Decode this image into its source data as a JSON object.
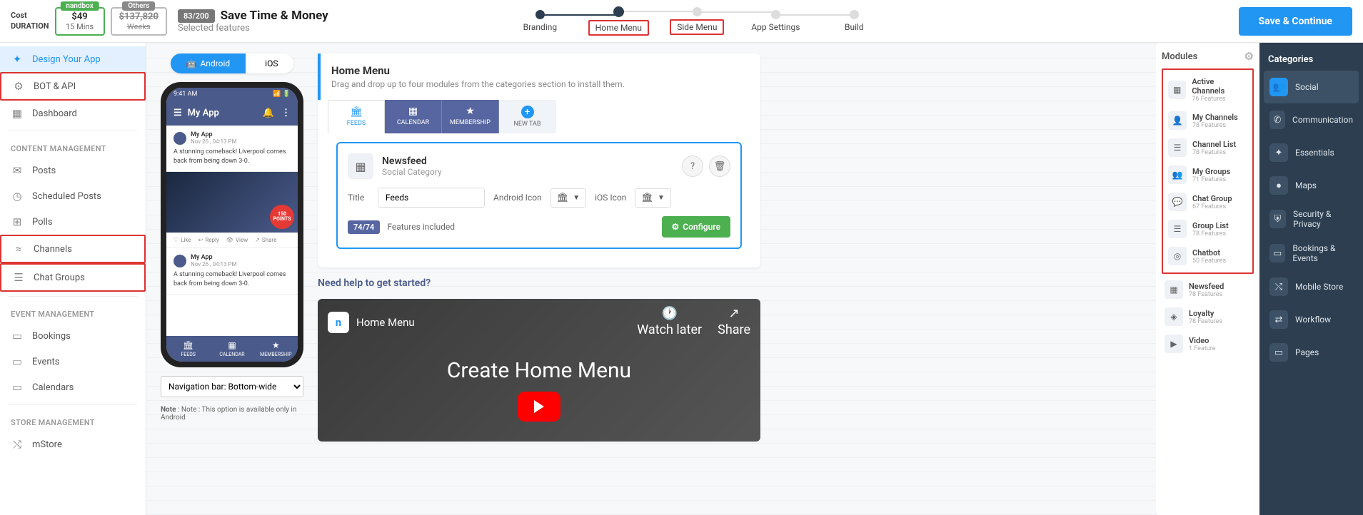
{
  "header": {
    "cost_label_line1": "Cost",
    "cost_label_line2": "DURATION",
    "nandbox": {
      "tag": "nandbox",
      "price": "$49",
      "time": "15 Mins"
    },
    "others": {
      "tag": "Others",
      "price": "$137,820",
      "time": "Weeks"
    },
    "counter": "83/200",
    "title": "Save Time & Money",
    "subtitle": "Selected features",
    "steps": [
      "Branding",
      "Home Menu",
      "Side Menu",
      "App Settings",
      "Build"
    ],
    "save_btn": "Save & Continue"
  },
  "sidebar": {
    "main": [
      {
        "icon": "✦",
        "label": "Design Your App"
      },
      {
        "icon": "⚙",
        "label": "BOT & API"
      },
      {
        "icon": "▦",
        "label": "Dashboard"
      }
    ],
    "content_section": "CONTENT MANAGEMENT",
    "content": [
      {
        "icon": "✉",
        "label": "Posts"
      },
      {
        "icon": "◷",
        "label": "Scheduled Posts"
      },
      {
        "icon": "⊞",
        "label": "Polls"
      },
      {
        "icon": "≈",
        "label": "Channels"
      },
      {
        "icon": "☰",
        "label": "Chat Groups"
      }
    ],
    "event_section": "EVENT MANAGEMENT",
    "event": [
      {
        "icon": "▭",
        "label": "Bookings"
      },
      {
        "icon": "▭",
        "label": "Events"
      },
      {
        "icon": "▭",
        "label": "Calendars"
      }
    ],
    "store_section": "STORE MANAGEMENT",
    "store": [
      {
        "icon": "⤭",
        "label": "mStore"
      }
    ]
  },
  "preview": {
    "platform_android": "Android",
    "platform_ios": "iOS",
    "time": "9:41 AM",
    "app_name": "My App",
    "post_author": "My App",
    "post_time": "Nov 26 , 04:13 PM",
    "post_body": "A stunning comeback! Liverpool comes back from being down 3-0.",
    "points_num": "150",
    "points_label": "POINTS",
    "like": "Like",
    "reply": "Reply",
    "view": "View",
    "share": "Share",
    "tabs": [
      "FEEDS",
      "CALENDAR",
      "MEMBERSHIP"
    ],
    "nav_select": "Navigation bar: Bottom-wide",
    "nav_note": "Note : This option is available only in Android"
  },
  "editor": {
    "home_title": "Home Menu",
    "home_sub": "Drag and drop up to four modules from the categories section to install them.",
    "tabs": [
      {
        "icon": "🏛",
        "label": "FEEDS"
      },
      {
        "icon": "▦",
        "label": "CALENDAR"
      },
      {
        "icon": "★",
        "label": "MEMBERSHIP"
      },
      {
        "icon": "+",
        "label": "NEW TAB"
      }
    ],
    "module": {
      "title": "Newsfeed",
      "category": "Social Category",
      "title_label": "Title",
      "title_value": "Feeds",
      "android_icon_label": "Android Icon",
      "ios_icon_label": "iOS Icon",
      "features_badge": "74/74",
      "features_text": "Features included",
      "configure": "Configure"
    },
    "help_title": "Need help to get started?",
    "video_title": "Home Menu",
    "video_main": "Create Home Menu",
    "watch_later": "Watch later",
    "share": "Share"
  },
  "modules": {
    "title": "Modules",
    "highlighted": [
      {
        "icon": "▦",
        "name": "Active Channels",
        "feat": "76 Features"
      },
      {
        "icon": "👤",
        "name": "My Channels",
        "feat": "78 Features"
      },
      {
        "icon": "☰",
        "name": "Channel List",
        "feat": "78 Features"
      },
      {
        "icon": "👥",
        "name": "My Groups",
        "feat": "71 Features"
      },
      {
        "icon": "💬",
        "name": "Chat Group",
        "feat": "67 Features"
      },
      {
        "icon": "☰",
        "name": "Group List",
        "feat": "78 Features"
      },
      {
        "icon": "◎",
        "name": "Chatbot",
        "feat": "50 Features"
      }
    ],
    "regular": [
      {
        "icon": "▦",
        "name": "Newsfeed",
        "feat": "78 Features"
      },
      {
        "icon": "◈",
        "name": "Loyalty",
        "feat": "78 Features"
      },
      {
        "icon": "▶",
        "name": "Video",
        "feat": "1 Feature"
      }
    ]
  },
  "categories": {
    "title": "Categories",
    "items": [
      {
        "icon": "👥",
        "label": "Social"
      },
      {
        "icon": "✆",
        "label": "Communication"
      },
      {
        "icon": "✦",
        "label": "Essentials"
      },
      {
        "icon": "●",
        "label": "Maps"
      },
      {
        "icon": "⛨",
        "label": "Security & Privacy"
      },
      {
        "icon": "▭",
        "label": "Bookings & Events"
      },
      {
        "icon": "⤭",
        "label": "Mobile Store"
      },
      {
        "icon": "⇄",
        "label": "Workflow"
      },
      {
        "icon": "▭",
        "label": "Pages"
      }
    ]
  }
}
